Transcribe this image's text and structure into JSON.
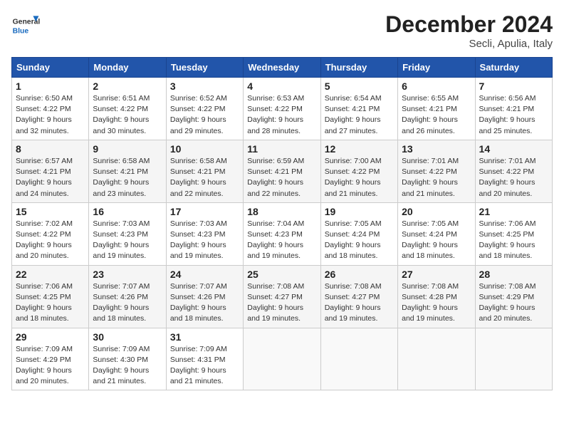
{
  "header": {
    "logo_general": "General",
    "logo_blue": "Blue",
    "month_title": "December 2024",
    "location": "Secli, Apulia, Italy"
  },
  "weekdays": [
    "Sunday",
    "Monday",
    "Tuesday",
    "Wednesday",
    "Thursday",
    "Friday",
    "Saturday"
  ],
  "weeks": [
    [
      {
        "day": "1",
        "sunrise": "6:50 AM",
        "sunset": "4:22 PM",
        "daylight": "9 hours and 32 minutes."
      },
      {
        "day": "2",
        "sunrise": "6:51 AM",
        "sunset": "4:22 PM",
        "daylight": "9 hours and 30 minutes."
      },
      {
        "day": "3",
        "sunrise": "6:52 AM",
        "sunset": "4:22 PM",
        "daylight": "9 hours and 29 minutes."
      },
      {
        "day": "4",
        "sunrise": "6:53 AM",
        "sunset": "4:22 PM",
        "daylight": "9 hours and 28 minutes."
      },
      {
        "day": "5",
        "sunrise": "6:54 AM",
        "sunset": "4:21 PM",
        "daylight": "9 hours and 27 minutes."
      },
      {
        "day": "6",
        "sunrise": "6:55 AM",
        "sunset": "4:21 PM",
        "daylight": "9 hours and 26 minutes."
      },
      {
        "day": "7",
        "sunrise": "6:56 AM",
        "sunset": "4:21 PM",
        "daylight": "9 hours and 25 minutes."
      }
    ],
    [
      {
        "day": "8",
        "sunrise": "6:57 AM",
        "sunset": "4:21 PM",
        "daylight": "9 hours and 24 minutes."
      },
      {
        "day": "9",
        "sunrise": "6:58 AM",
        "sunset": "4:21 PM",
        "daylight": "9 hours and 23 minutes."
      },
      {
        "day": "10",
        "sunrise": "6:58 AM",
        "sunset": "4:21 PM",
        "daylight": "9 hours and 22 minutes."
      },
      {
        "day": "11",
        "sunrise": "6:59 AM",
        "sunset": "4:21 PM",
        "daylight": "9 hours and 22 minutes."
      },
      {
        "day": "12",
        "sunrise": "7:00 AM",
        "sunset": "4:22 PM",
        "daylight": "9 hours and 21 minutes."
      },
      {
        "day": "13",
        "sunrise": "7:01 AM",
        "sunset": "4:22 PM",
        "daylight": "9 hours and 21 minutes."
      },
      {
        "day": "14",
        "sunrise": "7:01 AM",
        "sunset": "4:22 PM",
        "daylight": "9 hours and 20 minutes."
      }
    ],
    [
      {
        "day": "15",
        "sunrise": "7:02 AM",
        "sunset": "4:22 PM",
        "daylight": "9 hours and 20 minutes."
      },
      {
        "day": "16",
        "sunrise": "7:03 AM",
        "sunset": "4:23 PM",
        "daylight": "9 hours and 19 minutes."
      },
      {
        "day": "17",
        "sunrise": "7:03 AM",
        "sunset": "4:23 PM",
        "daylight": "9 hours and 19 minutes."
      },
      {
        "day": "18",
        "sunrise": "7:04 AM",
        "sunset": "4:23 PM",
        "daylight": "9 hours and 19 minutes."
      },
      {
        "day": "19",
        "sunrise": "7:05 AM",
        "sunset": "4:24 PM",
        "daylight": "9 hours and 18 minutes."
      },
      {
        "day": "20",
        "sunrise": "7:05 AM",
        "sunset": "4:24 PM",
        "daylight": "9 hours and 18 minutes."
      },
      {
        "day": "21",
        "sunrise": "7:06 AM",
        "sunset": "4:25 PM",
        "daylight": "9 hours and 18 minutes."
      }
    ],
    [
      {
        "day": "22",
        "sunrise": "7:06 AM",
        "sunset": "4:25 PM",
        "daylight": "9 hours and 18 minutes."
      },
      {
        "day": "23",
        "sunrise": "7:07 AM",
        "sunset": "4:26 PM",
        "daylight": "9 hours and 18 minutes."
      },
      {
        "day": "24",
        "sunrise": "7:07 AM",
        "sunset": "4:26 PM",
        "daylight": "9 hours and 18 minutes."
      },
      {
        "day": "25",
        "sunrise": "7:08 AM",
        "sunset": "4:27 PM",
        "daylight": "9 hours and 19 minutes."
      },
      {
        "day": "26",
        "sunrise": "7:08 AM",
        "sunset": "4:27 PM",
        "daylight": "9 hours and 19 minutes."
      },
      {
        "day": "27",
        "sunrise": "7:08 AM",
        "sunset": "4:28 PM",
        "daylight": "9 hours and 19 minutes."
      },
      {
        "day": "28",
        "sunrise": "7:08 AM",
        "sunset": "4:29 PM",
        "daylight": "9 hours and 20 minutes."
      }
    ],
    [
      {
        "day": "29",
        "sunrise": "7:09 AM",
        "sunset": "4:29 PM",
        "daylight": "9 hours and 20 minutes."
      },
      {
        "day": "30",
        "sunrise": "7:09 AM",
        "sunset": "4:30 PM",
        "daylight": "9 hours and 21 minutes."
      },
      {
        "day": "31",
        "sunrise": "7:09 AM",
        "sunset": "4:31 PM",
        "daylight": "9 hours and 21 minutes."
      },
      null,
      null,
      null,
      null
    ]
  ],
  "labels": {
    "sunrise": "Sunrise:",
    "sunset": "Sunset:",
    "daylight": "Daylight:"
  }
}
